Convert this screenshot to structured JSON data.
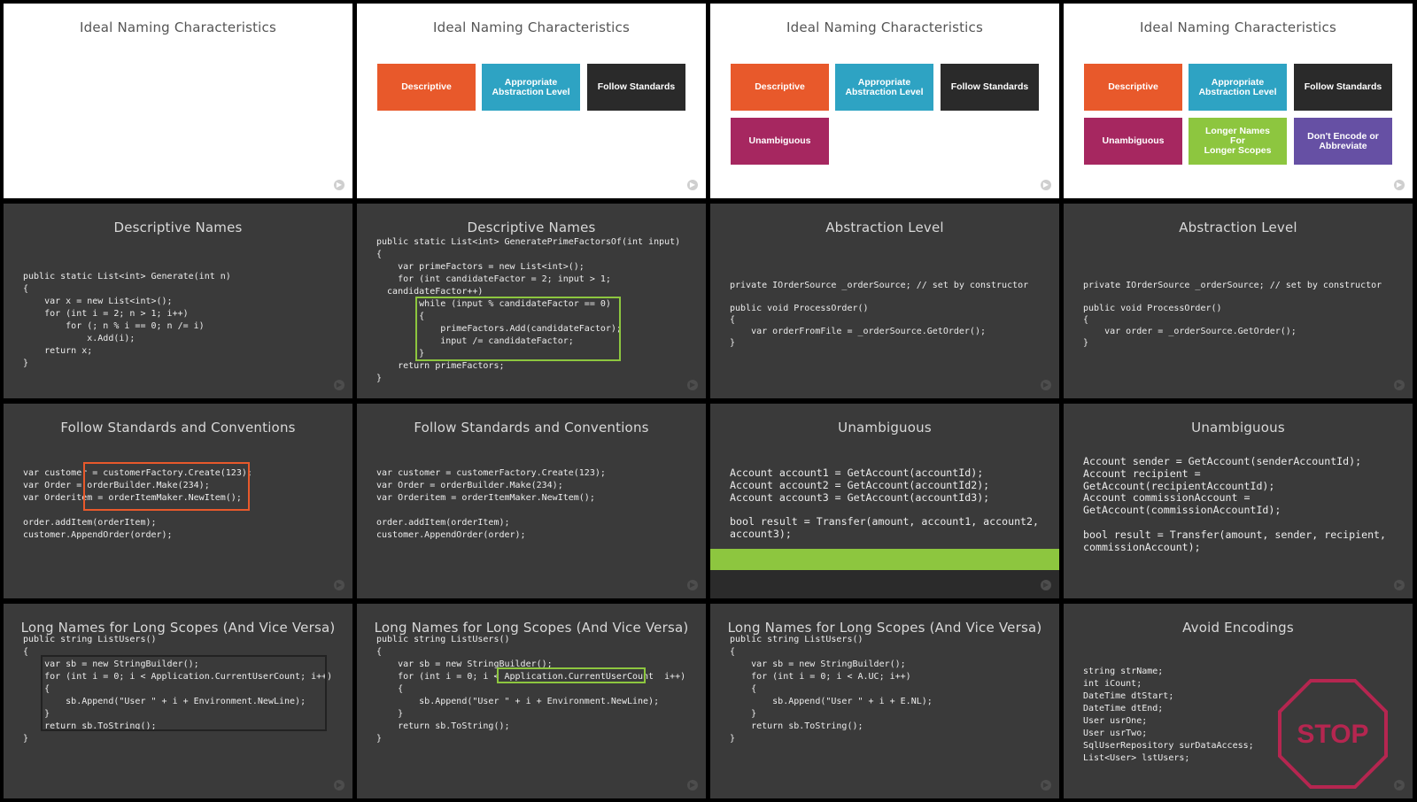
{
  "colors": {
    "descriptive": "#e8592b",
    "abstraction": "#2ea3c3",
    "standards": "#2a2a2a",
    "unambiguous": "#a62760",
    "longer": "#8dc63f",
    "encode": "#6650a4",
    "highlight_green": "#8dc63f",
    "highlight_orange": "#e8592b",
    "stop_sign": "#b52650"
  },
  "slides": {
    "s1": {
      "title": "Ideal Naming Characteristics"
    },
    "s2": {
      "title": "Ideal Naming Characteristics",
      "tiles": [
        "Descriptive",
        "Appropriate\nAbstraction Level",
        "Follow Standards"
      ]
    },
    "s3": {
      "title": "Ideal Naming Characteristics",
      "tiles": [
        "Descriptive",
        "Appropriate\nAbstraction Level",
        "Follow Standards",
        "Unambiguous"
      ]
    },
    "s4": {
      "title": "Ideal Naming Characteristics",
      "tiles": [
        "Descriptive",
        "Appropriate\nAbstraction Level",
        "Follow Standards",
        "Unambiguous",
        "Longer Names\nFor\nLonger Scopes",
        "Don't Encode or\nAbbreviate"
      ]
    },
    "s5": {
      "title": "Descriptive Names",
      "code": "public static List<int> Generate(int n)\n{\n    var x = new List<int>();\n    for (int i = 2; n > 1; i++)\n        for (; n % i == 0; n /= i)\n            x.Add(i);\n    return x;\n}"
    },
    "s6": {
      "title": "Descriptive Names",
      "code": "public static List<int> GeneratePrimeFactorsOf(int input)\n{\n    var primeFactors = new List<int>();\n    for (int candidateFactor = 2; input > 1;\n  candidateFactor++)\n        while (input % candidateFactor == 0)\n        {\n            primeFactors.Add(candidateFactor);\n            input /= candidateFactor;\n        }\n    return primeFactors;\n}"
    },
    "s7": {
      "title": "Abstraction Level",
      "code": "private IOrderSource _orderSource; // set by constructor\n\npublic void ProcessOrder()\n{\n    var orderFromFile = _orderSource.GetOrder();\n}"
    },
    "s8": {
      "title": "Abstraction Level",
      "code": "private IOrderSource _orderSource; // set by constructor\n\npublic void ProcessOrder()\n{\n    var order = _orderSource.GetOrder();\n}"
    },
    "s9": {
      "title": "Follow Standards and Conventions",
      "code": "var customer = customerFactory.Create(123);\nvar Order = orderBuilder.Make(234);\nvar Orderitem = orderItemMaker.NewItem();\n\norder.addItem(orderItem);\ncustomer.AppendOrder(order);"
    },
    "s10": {
      "title": "Follow Standards and Conventions",
      "code": "var customer = customerFactory.Create(123);\nvar Order = orderBuilder.Make(234);\nvar Orderitem = orderItemMaker.NewItem();\n\norder.addItem(orderItem);\ncustomer.AppendOrder(order);"
    },
    "s11": {
      "title": "Unambiguous",
      "code": "Account account1 = GetAccount(accountId);\nAccount account2 = GetAccount(accountId2);\nAccount account3 = GetAccount(accountId3);\n\nbool result = Transfer(amount, account1, account2,\naccount3);"
    },
    "s12": {
      "title": "Unambiguous",
      "code": "Account sender = GetAccount(senderAccountId);\nAccount recipient =\nGetAccount(recipientAccountId);\nAccount commissionAccount =\nGetAccount(commissionAccountId);\n\nbool result = Transfer(amount, sender, recipient,\ncommissionAccount);"
    },
    "s13": {
      "title": "Long Names for Long Scopes (And Vice Versa)",
      "code": "public string ListUsers()\n{\n    var sb = new StringBuilder();\n    for (int i = 0; i < Application.CurrentUserCount; i++)\n    {\n        sb.Append(\"User \" + i + Environment.NewLine);\n    }\n    return sb.ToString();\n}"
    },
    "s14": {
      "title": "Long Names for Long Scopes (And Vice Versa)",
      "code": "public string ListUsers()\n{\n    var sb = new StringBuilder();\n    for (int i = 0; i < Application.CurrentUserCount  i++)\n    {\n        sb.Append(\"User \" + i + Environment.NewLine);\n    }\n    return sb.ToString();\n}"
    },
    "s15": {
      "title": "Long Names for Long Scopes (And Vice Versa)",
      "code": "public string ListUsers()\n{\n    var sb = new StringBuilder();\n    for (int i = 0; i < A.UC; i++)\n    {\n        sb.Append(\"User \" + i + E.NL);\n    }\n    return sb.ToString();\n}"
    },
    "s16": {
      "title": "Avoid Encodings",
      "code": "string strName;\nint iCount;\nDateTime dtStart;\nDateTime dtEnd;\nUser usrOne;\nUser usrTwo;\nSqlUserRepository surDataAccess;\nList<User> lstUsers;",
      "stop_text": "STOP"
    }
  }
}
